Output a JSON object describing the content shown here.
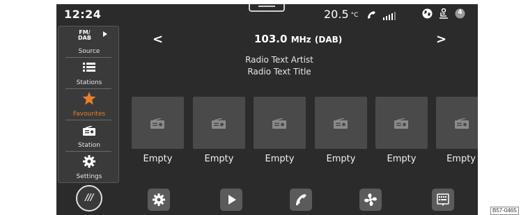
{
  "status_bar": {
    "time": "12:24",
    "temperature_value": "20.5",
    "temperature_unit": "°C",
    "notification_count": "4",
    "icons": [
      "phone-icon",
      "signal-icon",
      "globe-icon",
      "person-seat-icon",
      "notification-badge"
    ]
  },
  "sidebar": {
    "source_top": "FM/",
    "source_bottom": "DAB",
    "items": [
      {
        "label": "Source",
        "icon": "fm-dab-icon"
      },
      {
        "label": "Stations",
        "icon": "list-icon"
      },
      {
        "label": "Favourites",
        "icon": "star-icon",
        "active": true
      },
      {
        "label": "Station",
        "icon": "radio-icon"
      },
      {
        "label": "Settings",
        "icon": "gear-icon"
      }
    ]
  },
  "header": {
    "frequency": "103.0",
    "unit": "MHz",
    "band": "(DAB)",
    "prev": "<",
    "next": ">"
  },
  "radio_text": {
    "artist": "Radio Text Artist",
    "title": "Radio Text Title"
  },
  "presets": [
    {
      "label": "Empty"
    },
    {
      "label": "Empty"
    },
    {
      "label": "Empty"
    },
    {
      "label": "Empty"
    },
    {
      "label": "Empty"
    },
    {
      "label": "Empty"
    }
  ],
  "bottom_bar": {
    "home": "///",
    "buttons": [
      "settings-icon",
      "play-icon",
      "phone-icon",
      "fan-icon",
      "keyboard-icon"
    ]
  },
  "reference_code": "B57-0465",
  "colors": {
    "screen_background": "#2b2b2b",
    "accent_orange": "#e8802a",
    "tile_background": "#4a4a4a"
  }
}
